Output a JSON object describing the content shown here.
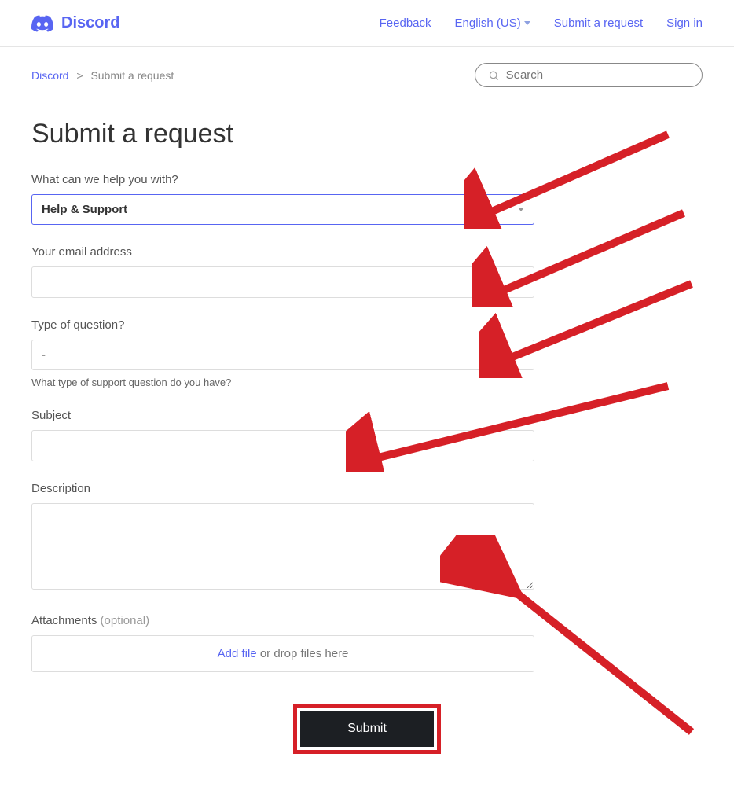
{
  "header": {
    "brand": "Discord",
    "nav": {
      "feedback": "Feedback",
      "language": "English (US)",
      "submit": "Submit a request",
      "signin": "Sign in"
    }
  },
  "breadcrumb": {
    "root": "Discord",
    "current": "Submit a request"
  },
  "search": {
    "placeholder": "Search"
  },
  "page": {
    "title": "Submit a request"
  },
  "form": {
    "help_label": "What can we help you with?",
    "help_value": "Help & Support",
    "email_label": "Your email address",
    "email_value": "",
    "type_label": "Type of question?",
    "type_value": "-",
    "type_hint": "What type of support question do you have?",
    "subject_label": "Subject",
    "subject_value": "",
    "description_label": "Description",
    "description_value": "",
    "attachments_label": "Attachments",
    "attachments_optional": "(optional)",
    "addfile_link": "Add file",
    "addfile_rest": " or drop files here",
    "submit_label": "Submit"
  }
}
